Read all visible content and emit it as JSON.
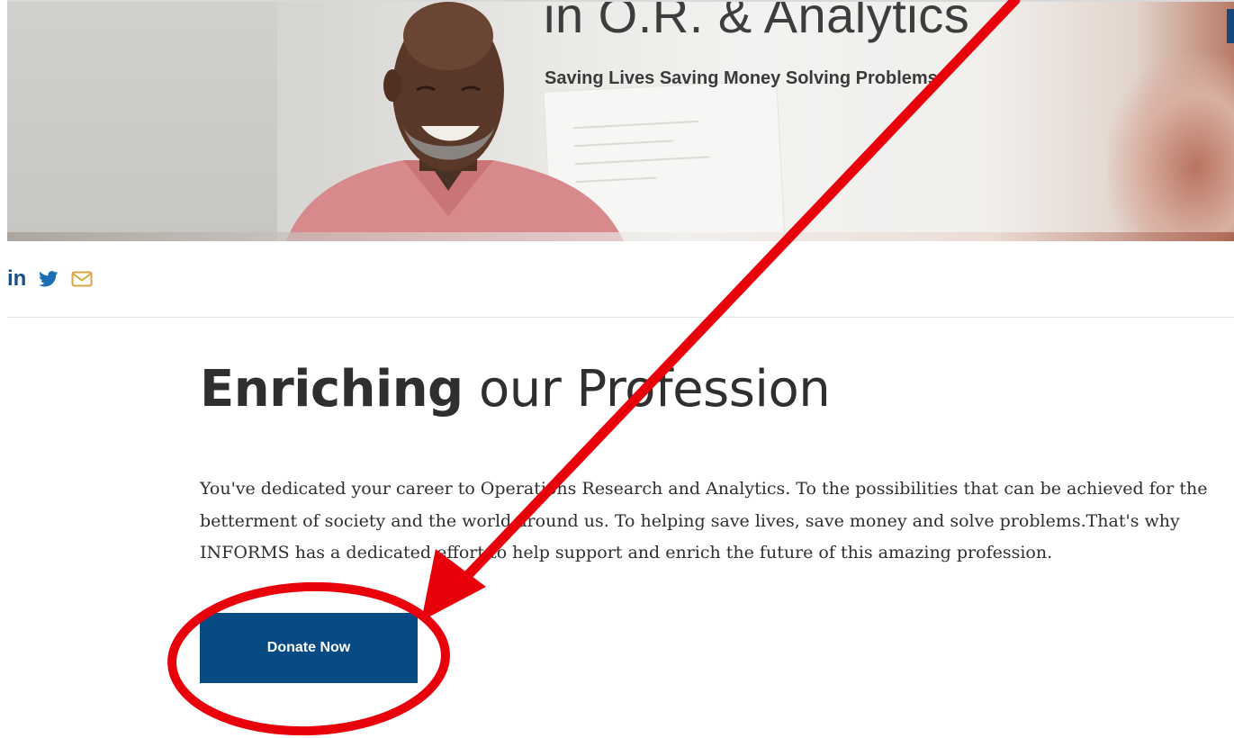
{
  "hero": {
    "title": "in O.R. & Analytics",
    "subtitle": "Saving Lives Saving Money Solving Problems"
  },
  "social": {
    "linkedin_glyph": "in",
    "icons": [
      "linkedin-icon",
      "twitter-icon",
      "mail-icon"
    ]
  },
  "content": {
    "heading_bold": "Enriching",
    "heading_rest": " our Profession",
    "body": "You've dedicated your career to Operations Research and Analytics. To the possibilities that can be achieved for the betterment of society and the world around us. To helping save lives, save money and solve problems.That's why INFORMS has a dedicated effort to help support and enrich the future of this amazing profession.",
    "donate_label": "Donate Now"
  },
  "colors": {
    "brand_blue": "#074a84",
    "twitter_blue": "#1d6fb5",
    "mail_gold": "#d9a441",
    "annotation_red": "#e8000b"
  }
}
